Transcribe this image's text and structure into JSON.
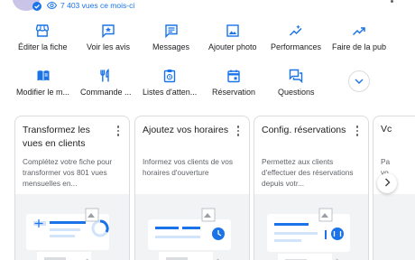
{
  "profile": {
    "views_text": "7 403 vues ce mois-ci"
  },
  "actions_row1": [
    {
      "label": "Éditer la fiche",
      "icon": "storefront-icon"
    },
    {
      "label": "Voir les avis",
      "icon": "star-review-icon"
    },
    {
      "label": "Messages",
      "icon": "message-icon"
    },
    {
      "label": "Ajouter photo",
      "icon": "photo-icon"
    },
    {
      "label": "Performances",
      "icon": "trending-sparkle-icon"
    },
    {
      "label": "Faire de la pub",
      "icon": "trending-up-icon"
    }
  ],
  "actions_row2": [
    {
      "label": "Modifier le m...",
      "icon": "menu-book-icon"
    },
    {
      "label": "Commande ...",
      "icon": "restaurant-icon"
    },
    {
      "label": "Listes d'atten...",
      "icon": "waitlist-clipboard-icon"
    },
    {
      "label": "Réservation",
      "icon": "calendar-icon"
    },
    {
      "label": "Questions",
      "icon": "question-answer-icon"
    },
    {
      "label": "",
      "icon": "chevron-down-icon"
    }
  ],
  "cards": [
    {
      "title": "Transformez les vues en clients",
      "description": "Complétez votre fiche pour transformer vos 801 vues mensuelles en..."
    },
    {
      "title": "Ajoutez vos horaires",
      "description": "Informez vos clients de vos horaires d'ouverture"
    },
    {
      "title": "Config. réservations",
      "description": "Permettez aux clients d'effectuer des réservations depuis votr..."
    },
    {
      "title": "Vc",
      "description": "Pa\nvo"
    }
  ],
  "colors": {
    "accent": "#1a73e8",
    "text": "#202124",
    "secondary_text": "#5f6368",
    "border": "#dadce0",
    "illustration_bg": "#f1f3f4"
  }
}
